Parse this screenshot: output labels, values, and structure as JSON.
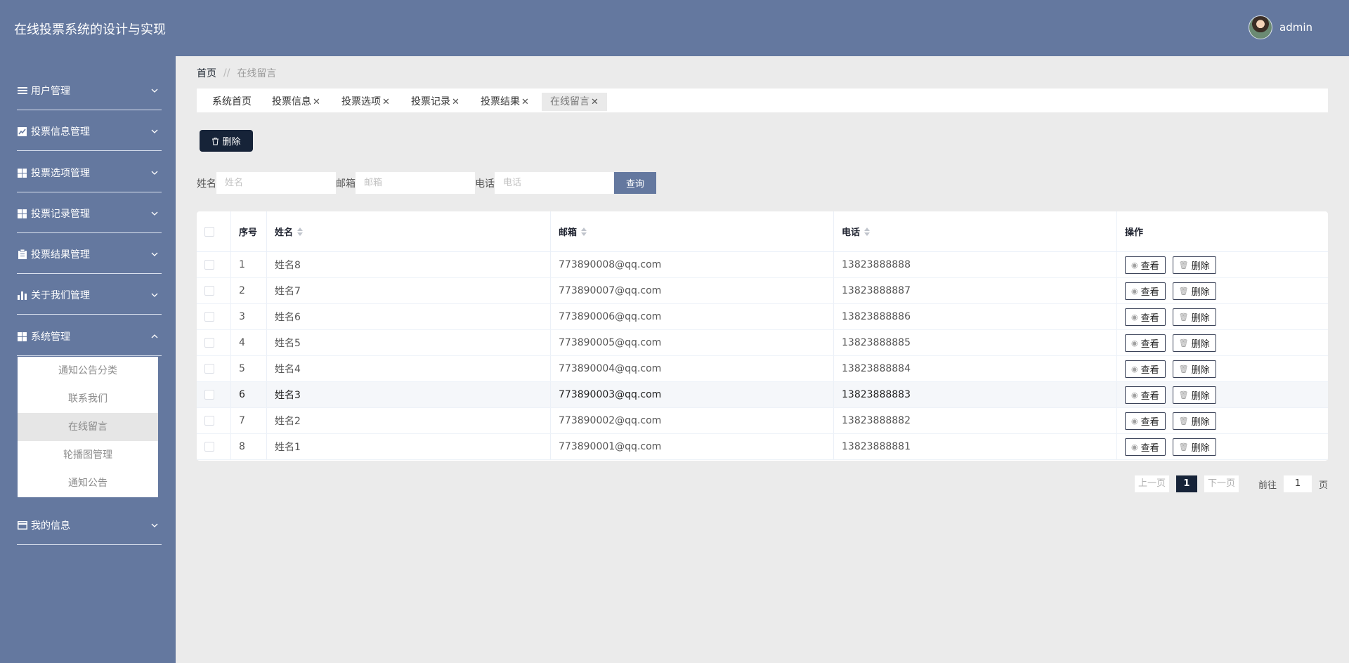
{
  "app": {
    "title": "在线投票系统的设计与实现",
    "user": "admin"
  },
  "sidebar": {
    "items": [
      {
        "label": "用户管理",
        "icon": "list-icon"
      },
      {
        "label": "投票信息管理",
        "icon": "chart-line-icon"
      },
      {
        "label": "投票选项管理",
        "icon": "grid-icon"
      },
      {
        "label": "投票记录管理",
        "icon": "grid-icon"
      },
      {
        "label": "投票结果管理",
        "icon": "clipboard-icon"
      },
      {
        "label": "关于我们管理",
        "icon": "bar-chart-icon"
      },
      {
        "label": "系统管理",
        "icon": "grid-icon",
        "expanded": true
      },
      {
        "label": "我的信息",
        "icon": "card-icon"
      }
    ],
    "submenu": [
      "通知公告分类",
      "联系我们",
      "在线留言",
      "轮播图管理",
      "通知公告"
    ],
    "active_sub": "在线留言"
  },
  "breadcrumb": {
    "home": "首页",
    "sep": "//",
    "current": "在线留言"
  },
  "tabs": [
    "系统首页",
    "投票信息",
    "投票选项",
    "投票记录",
    "投票结果",
    "在线留言"
  ],
  "toolbar": {
    "delete_label": "删除"
  },
  "search": {
    "name_label": "姓名",
    "name_placeholder": "姓名",
    "email_label": "邮箱",
    "email_placeholder": "邮箱",
    "phone_label": "电话",
    "phone_placeholder": "电话",
    "query_label": "查询"
  },
  "table": {
    "headers": [
      "序号",
      "姓名",
      "邮箱",
      "电话",
      "操作"
    ],
    "view_label": "查看",
    "delete_label": "删除",
    "rows": [
      {
        "no": "1",
        "name": "姓名8",
        "email": "773890008@qq.com",
        "phone": "13823888888"
      },
      {
        "no": "2",
        "name": "姓名7",
        "email": "773890007@qq.com",
        "phone": "13823888887"
      },
      {
        "no": "3",
        "name": "姓名6",
        "email": "773890006@qq.com",
        "phone": "13823888886"
      },
      {
        "no": "4",
        "name": "姓名5",
        "email": "773890005@qq.com",
        "phone": "13823888885"
      },
      {
        "no": "5",
        "name": "姓名4",
        "email": "773890004@qq.com",
        "phone": "13823888884"
      },
      {
        "no": "6",
        "name": "姓名3",
        "email": "773890003@qq.com",
        "phone": "13823888883"
      },
      {
        "no": "7",
        "name": "姓名2",
        "email": "773890002@qq.com",
        "phone": "13823888882"
      },
      {
        "no": "8",
        "name": "姓名1",
        "email": "773890001@qq.com",
        "phone": "13823888881"
      }
    ]
  },
  "pagination": {
    "prev": "上一页",
    "current": "1",
    "next": "下一页",
    "goto": "前往",
    "goto_value": "1",
    "unit": "页"
  },
  "colors": {
    "sidebar": "#64789f",
    "accent": "#162338"
  }
}
